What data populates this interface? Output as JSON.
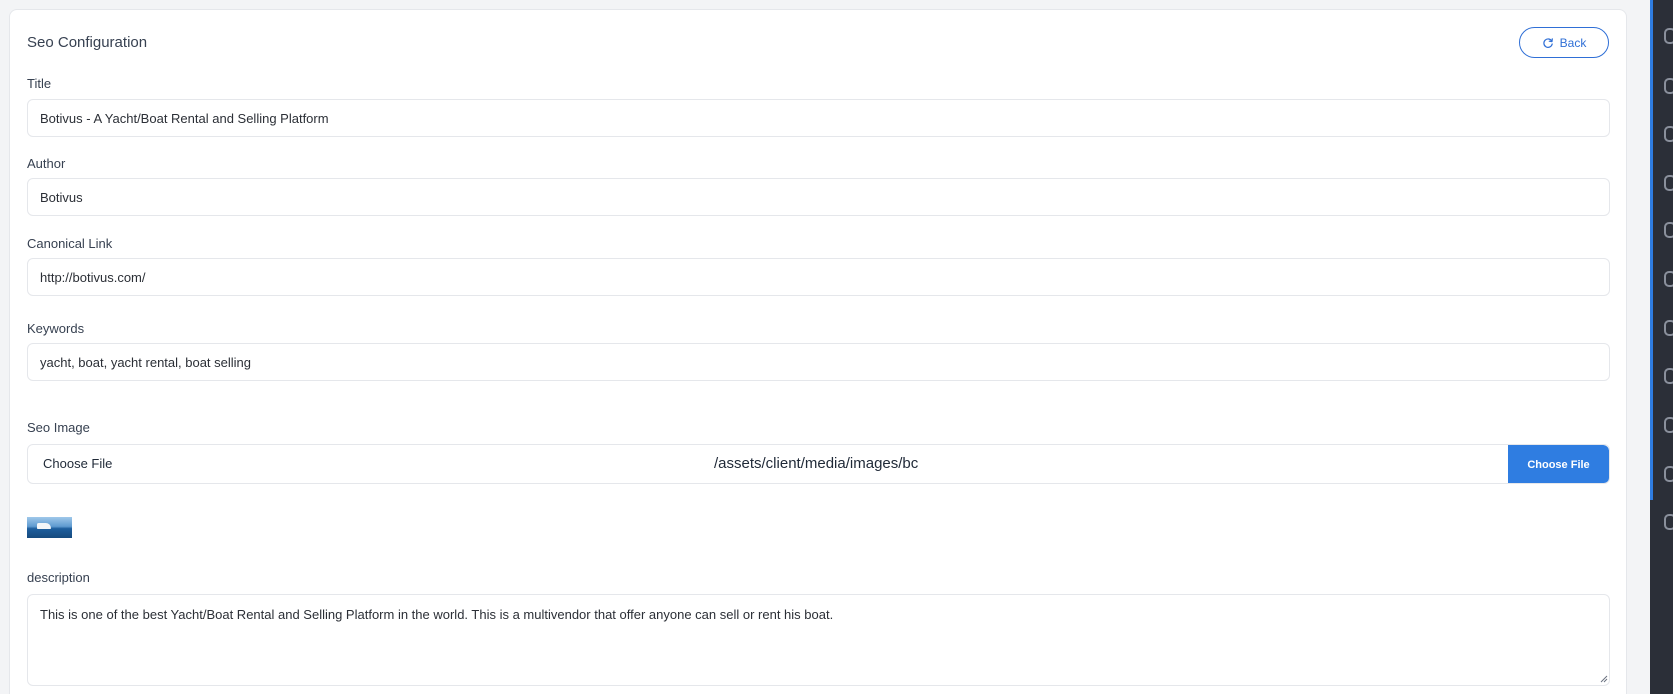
{
  "header": {
    "title": "Seo Configuration",
    "back_label": "Back"
  },
  "form": {
    "title": {
      "label": "Title",
      "value": "Botivus - A Yacht/Boat Rental and Selling Platform"
    },
    "author": {
      "label": "Author",
      "value": "Botivus"
    },
    "canonical": {
      "label": "Canonical Link",
      "value": "http://botivus.com/"
    },
    "keywords": {
      "label": "Keywords",
      "value": "yacht, boat, yacht rental, boat selling"
    },
    "seo_image": {
      "label": "Seo Image",
      "native_label": "Choose File",
      "path": "/assets/client/media/images/bc",
      "button_label": "Choose File"
    },
    "description": {
      "label": "description",
      "value": "This is one of the best Yacht/Boat Rental and Selling Platform in the world. This is a multivendor that offer anyone can sell or rent his boat."
    }
  },
  "colors": {
    "accent": "#2f7de1",
    "sidebar": "#2b2f38"
  },
  "icons": [
    "refresh-icon",
    "sidebar-nav-icon"
  ]
}
